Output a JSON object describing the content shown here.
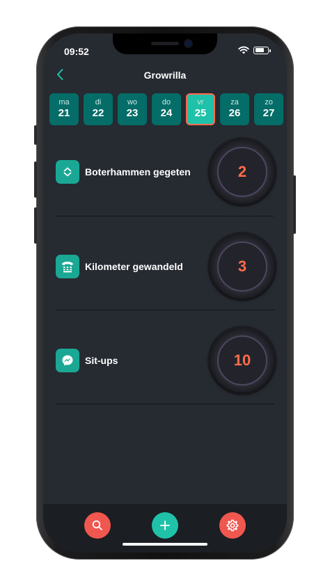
{
  "status_bar": {
    "time": "09:52"
  },
  "header": {
    "title": "Growrilla",
    "back_icon": "chevron-left-icon"
  },
  "days": [
    {
      "name": "ma",
      "date": "21"
    },
    {
      "name": "di",
      "date": "22"
    },
    {
      "name": "wo",
      "date": "23"
    },
    {
      "name": "do",
      "date": "24"
    },
    {
      "name": "vr",
      "date": "25",
      "selected": true
    },
    {
      "name": "za",
      "date": "26"
    },
    {
      "name": "zo",
      "date": "27"
    }
  ],
  "activities": [
    {
      "label": "Boterhammen gegeten",
      "count": "2",
      "icon": "expand-collapse-icon"
    },
    {
      "label": "Kilometer gewandeld",
      "count": "3",
      "icon": "phone-keypad-icon"
    },
    {
      "label": "Sit-ups",
      "count": "10",
      "icon": "messenger-icon"
    }
  ],
  "tabbar": {
    "search_icon": "search-icon",
    "add_icon": "plus-icon",
    "settings_icon": "gear-icon"
  },
  "colors": {
    "accent": "#1fc2a9",
    "day_bg": "#046d68",
    "counter_text": "#ff6b4a",
    "search_button": "#f0574f",
    "add_button": "#1fc2a9",
    "settings_button": "#f0574f",
    "background": "#262a31"
  }
}
